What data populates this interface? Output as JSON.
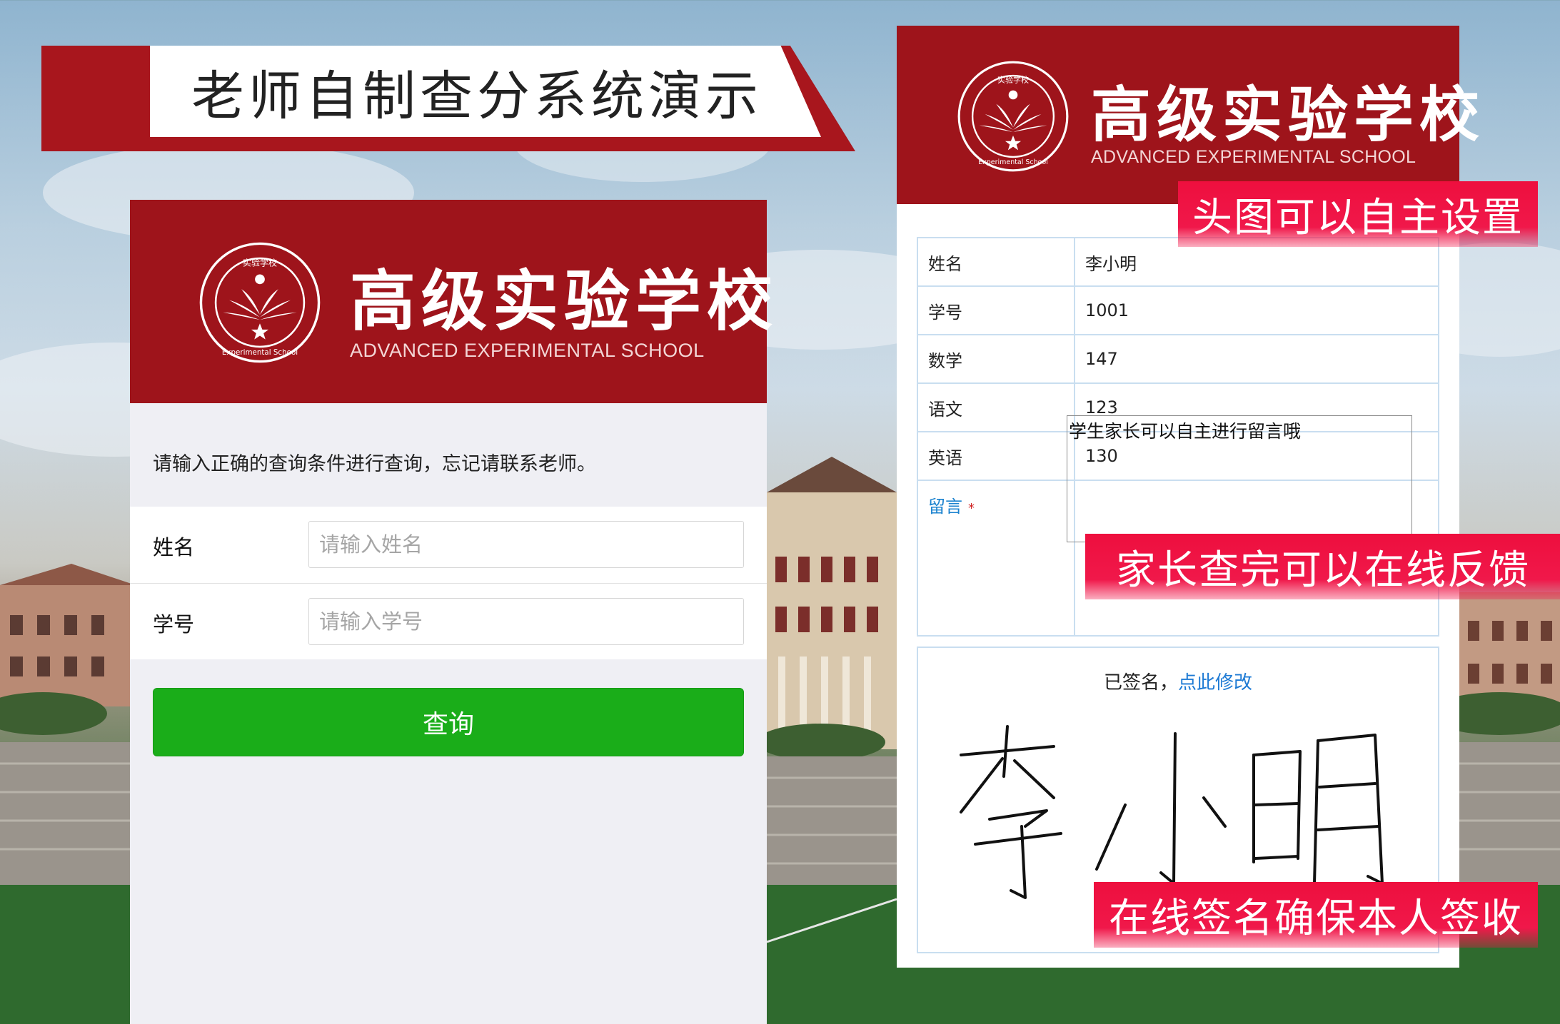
{
  "banner": {
    "title": "老师自制查分系统演示"
  },
  "school": {
    "name_cn": "高级实验学校",
    "name_en": "ADVANCED EXPERIMENTAL SCHOOL",
    "logo_top": "实验学校",
    "logo_bottom": "Experimental School",
    "brand_color": "#9e141b"
  },
  "query_page": {
    "notice": "请输入正确的查询条件进行查询，忘记请联系老师。",
    "fields": [
      {
        "label": "姓名",
        "placeholder": "请输入姓名"
      },
      {
        "label": "学号",
        "placeholder": "请输入学号"
      }
    ],
    "submit_label": "查询",
    "submit_color": "#1aad19"
  },
  "result_page": {
    "rows": [
      {
        "key": "姓名",
        "value": "李小明"
      },
      {
        "key": "学号",
        "value": "1001"
      },
      {
        "key": "数学",
        "value": "147"
      },
      {
        "key": "语文",
        "value": "123"
      },
      {
        "key": "英语",
        "value": "130"
      }
    ],
    "message_label": "留言",
    "message_required_mark": "*",
    "message_text": "学生家长可以自主进行留言哦",
    "signature_status": "已签名，",
    "signature_edit_link": "点此修改",
    "signature_name": "李小明"
  },
  "callouts": {
    "header": "头图可以自主设置",
    "feedback": "家长查完可以在线反馈",
    "signature": "在线签名确保本人签收"
  }
}
